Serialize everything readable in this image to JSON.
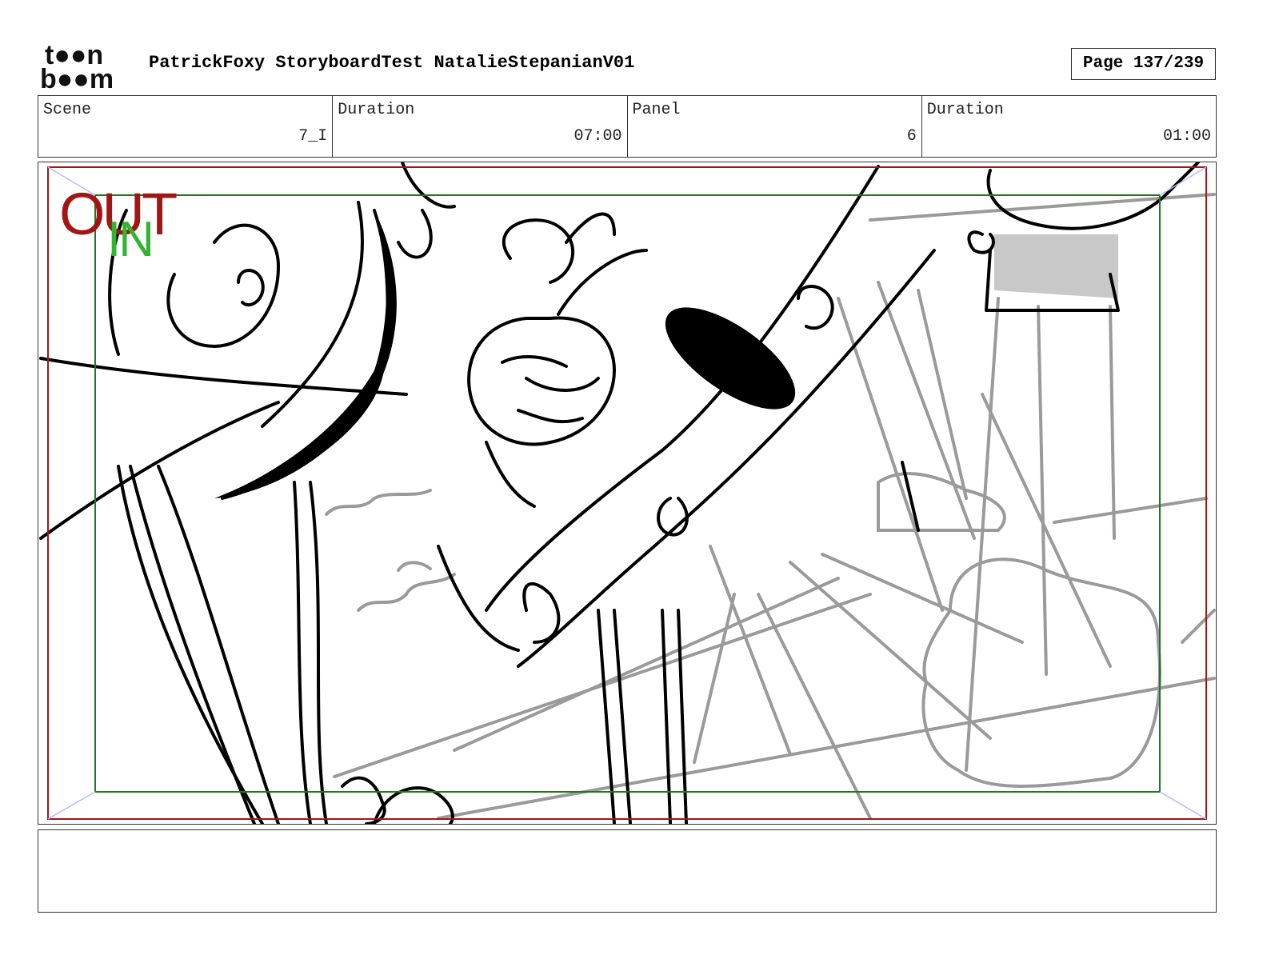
{
  "header": {
    "logo_top": "t●●n",
    "logo_bottom": "b●●m",
    "project_title": "PatrickFoxy StoryboardTest NatalieStepanianV01",
    "page_label": "Page 137/239"
  },
  "info": {
    "scene_label": "Scene",
    "scene_value": "7_I",
    "scene_duration_label": "Duration",
    "scene_duration_value": "07:00",
    "panel_label": "Panel",
    "panel_value": "6",
    "panel_duration_label": "Duration",
    "panel_duration_value": "01:00"
  },
  "panel": {
    "out_label": "OUT",
    "in_label": "IN",
    "colors": {
      "out_frame": "#a31515",
      "in_frame": "#1e7a1e",
      "in_text": "#2fb52f",
      "sketch_dark": "#000000",
      "sketch_grey": "#9a9a9a",
      "fill_grey": "#c8c8c8"
    }
  },
  "caption": {
    "text": ""
  }
}
